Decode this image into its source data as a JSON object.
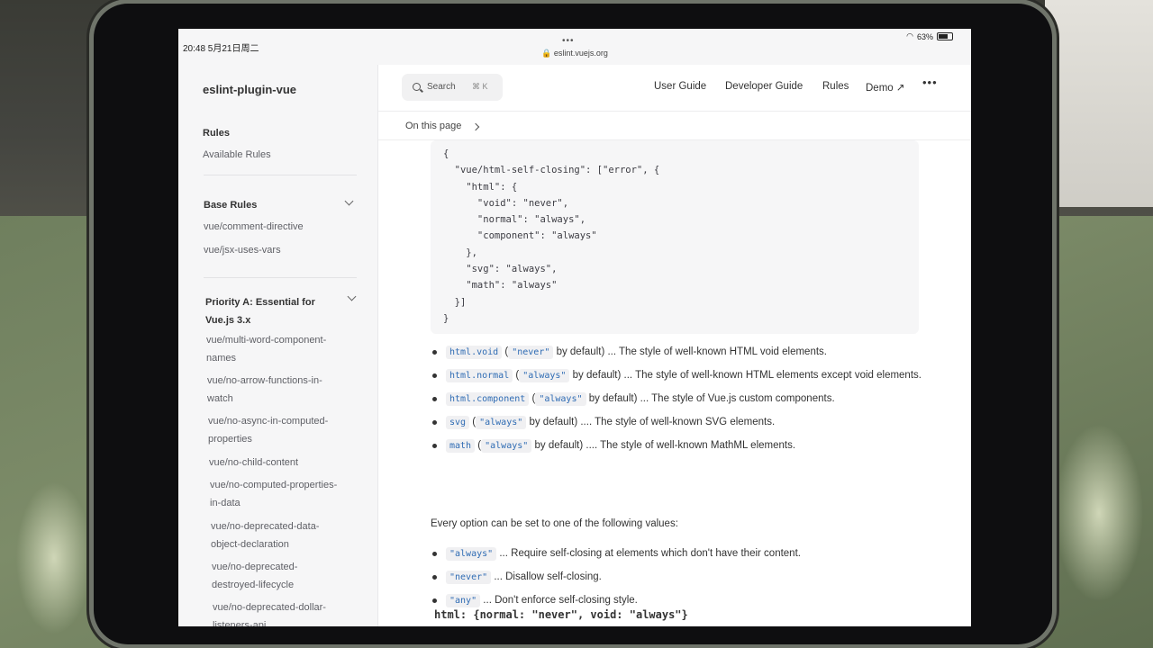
{
  "status_bar": {
    "time": "20:48  5月21日周二",
    "dots": "•••",
    "url": "🔒 eslint.vuejs.org",
    "battery_pct": "63%"
  },
  "sidebar": {
    "site_title": "eslint-plugin-vue",
    "rules_heading": "Rules",
    "available_rules": "Available Rules",
    "base_rules_heading": "Base Rules",
    "base_rules": [
      "vue/comment-directive",
      "vue/jsx-uses-vars"
    ],
    "priority_heading_1": "Priority A: Essential for",
    "priority_heading_2": "Vue.js 3.x",
    "priority_rules": [
      [
        "vue/multi-word-component-",
        "names"
      ],
      [
        "vue/no-arrow-functions-in-",
        "watch"
      ],
      [
        "vue/no-async-in-computed-",
        "properties"
      ],
      [
        "vue/no-child-content"
      ],
      [
        "vue/no-computed-properties-",
        "in-data"
      ],
      [
        "vue/no-deprecated-data-",
        "object-declaration"
      ],
      [
        "vue/no-deprecated-",
        "destroyed-lifecycle"
      ],
      [
        "vue/no-deprecated-dollar-",
        "listeners-api"
      ]
    ]
  },
  "topnav": {
    "search_label": "Search",
    "search_kbd": "⌘ K",
    "links": [
      "User Guide",
      "Developer Guide",
      "Rules",
      "Demo ↗"
    ],
    "more": "•••"
  },
  "on_this_page": "On this page",
  "code": {
    "lines": [
      "{",
      "  \"vue/html-self-closing\": [\"error\", {",
      "    \"html\": {",
      "      \"void\": \"never\",",
      "      \"normal\": \"always\",",
      "      \"component\": \"always\"",
      "    },",
      "    \"svg\": \"always\",",
      "    \"math\": \"always\"",
      "  }]",
      "}"
    ]
  },
  "options": [
    {
      "code": "html.void",
      "default": "\"never\"",
      "text": " by default) ... The style of well-known HTML void elements."
    },
    {
      "code": "html.normal",
      "default": "\"always\"",
      "text": " by default) ... The style of well-known HTML elements except void elements."
    },
    {
      "code": "html.component",
      "default": "\"always\"",
      "text": " by default) ... The style of Vue.js custom components."
    },
    {
      "code": "svg",
      "default": "\"always\"",
      "text": " by default) .... The style of well-known SVG elements."
    },
    {
      "code": "math",
      "default": "\"always\"",
      "text": " by default) .... The style of well-known MathML elements."
    }
  ],
  "values_intro": "Every option can be set to one of the following values:",
  "values": [
    {
      "code": "\"always\"",
      "text": " ... Require self-closing at elements which don't have their content."
    },
    {
      "code": "\"never\"",
      "text": " ... Disallow self-closing."
    },
    {
      "code": "\"any\"",
      "text": " ... Don't enforce self-closing style."
    }
  ],
  "bottom_heading": "html: {normal: \"never\", void: \"always\"}"
}
